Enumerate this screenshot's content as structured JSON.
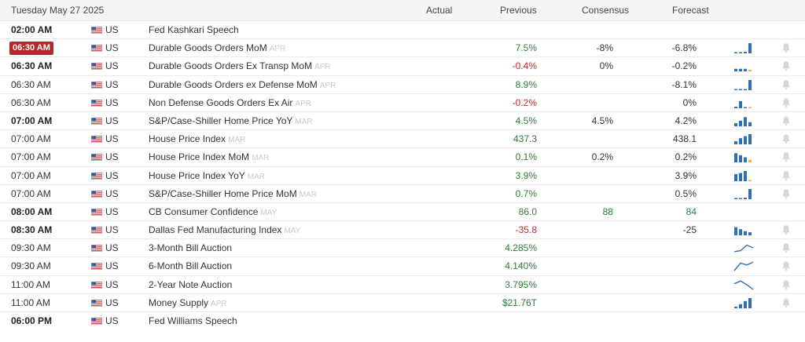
{
  "header": {
    "date": "Tuesday May 27 2025",
    "col_actual": "Actual",
    "col_previous": "Previous",
    "col_consensus": "Consensus",
    "col_forecast": "Forecast"
  },
  "colors": {
    "positive": "#2e7d32",
    "negative": "#c62828",
    "live_badge": "#b22a2a",
    "spark_blue": "#2f6fb5",
    "spark_yellow": "#f0b23a"
  },
  "rows": [
    {
      "time": "02:00 AM",
      "time_style": "bold",
      "country": "US",
      "event": "Fed Kashkari Speech",
      "ref": "",
      "actual": "",
      "previous": "",
      "previous_tone": "neutral",
      "consensus": "",
      "forecast": "",
      "spark": "none",
      "bell": false
    },
    {
      "time": "06:30 AM",
      "time_style": "live",
      "country": "US",
      "event": "Durable Goods Orders MoM",
      "ref": "APR",
      "actual": "",
      "previous": "7.5%",
      "previous_tone": "pos",
      "consensus": "-8%",
      "forecast": "-6.8%",
      "spark": "bars",
      "bars": [
        0.1,
        0.1,
        0.15,
        1.0
      ],
      "bell": true
    },
    {
      "time": "06:30 AM",
      "time_style": "bold",
      "country": "US",
      "event": "Durable Goods Orders Ex Transp MoM",
      "ref": "APR",
      "actual": "",
      "previous": "-0.4%",
      "previous_tone": "neg",
      "consensus": "0%",
      "forecast": "-0.2%",
      "spark": "bars",
      "bars": [
        0.25,
        0.25,
        0.25,
        0.15
      ],
      "bell": true
    },
    {
      "time": "06:30 AM",
      "time_style": "normal",
      "country": "US",
      "event": "Durable Goods Orders ex Defense MoM",
      "ref": "APR",
      "actual": "",
      "previous": "8.9%",
      "previous_tone": "pos",
      "consensus": "",
      "forecast": "-8.1%",
      "spark": "bars",
      "bars": [
        0.1,
        0.1,
        0.1,
        1.0
      ],
      "bell": true
    },
    {
      "time": "06:30 AM",
      "time_style": "normal",
      "country": "US",
      "event": "Non Defense Goods Orders Ex Air",
      "ref": "APR",
      "actual": "",
      "previous": "-0.2%",
      "previous_tone": "neg",
      "consensus": "",
      "forecast": "0%",
      "spark": "bars",
      "bars": [
        0.15,
        0.7,
        0.1,
        0.1
      ],
      "bell": true
    },
    {
      "time": "07:00 AM",
      "time_style": "bold",
      "country": "US",
      "event": "S&P/Case-Shiller Home Price YoY",
      "ref": "MAR",
      "actual": "",
      "previous": "4.5%",
      "previous_tone": "pos",
      "consensus": "4.5%",
      "forecast": "4.2%",
      "spark": "bars",
      "bars": [
        0.3,
        0.55,
        0.9,
        0.4
      ],
      "bell": true
    },
    {
      "time": "07:00 AM",
      "time_style": "normal",
      "country": "US",
      "event": "House Price Index",
      "ref": "MAR",
      "actual": "",
      "previous": "437.3",
      "previous_tone": "pos",
      "consensus": "",
      "forecast": "438.1",
      "spark": "bars",
      "bars": [
        0.3,
        0.6,
        0.8,
        1.0
      ],
      "bell": true
    },
    {
      "time": "07:00 AM",
      "time_style": "normal",
      "country": "US",
      "event": "House Price Index MoM",
      "ref": "MAR",
      "actual": "",
      "previous": "0.1%",
      "previous_tone": "pos",
      "consensus": "0.2%",
      "forecast": "0.2%",
      "spark": "bars",
      "bars": [
        0.9,
        0.7,
        0.5,
        0.25
      ],
      "bell": true
    },
    {
      "time": "07:00 AM",
      "time_style": "normal",
      "country": "US",
      "event": "House Price Index YoY",
      "ref": "MAR",
      "actual": "",
      "previous": "3.9%",
      "previous_tone": "pos",
      "consensus": "",
      "forecast": "3.9%",
      "spark": "bars",
      "bars": [
        0.7,
        0.8,
        1.0,
        0.1
      ],
      "bell": true
    },
    {
      "time": "07:00 AM",
      "time_style": "normal",
      "country": "US",
      "event": "S&P/Case-Shiller Home Price MoM",
      "ref": "MAR",
      "actual": "",
      "previous": "0.7%",
      "previous_tone": "pos",
      "consensus": "",
      "forecast": "0.5%",
      "spark": "bars",
      "bars": [
        0.1,
        0.1,
        0.15,
        1.0
      ],
      "bell": true
    },
    {
      "time": "08:00 AM",
      "time_style": "bold",
      "country": "US",
      "event": "CB Consumer Confidence",
      "ref": "MAY",
      "actual": "",
      "previous": "86.0",
      "previous_tone": "pos",
      "consensus": "88",
      "consensus_tone": "pos",
      "forecast": "84",
      "forecast_tone": "pos",
      "spark": "none",
      "bell": false
    },
    {
      "time": "08:30 AM",
      "time_style": "bold",
      "country": "US",
      "event": "Dallas Fed Manufacturing Index",
      "ref": "MAY",
      "actual": "",
      "previous": "-35.8",
      "previous_tone": "neg",
      "consensus": "",
      "forecast": "-25",
      "spark": "bars",
      "bars": [
        0.8,
        0.6,
        0.4,
        0.3
      ],
      "bell": true
    },
    {
      "time": "09:30 AM",
      "time_style": "normal",
      "country": "US",
      "event": "3-Month Bill Auction",
      "ref": "",
      "actual": "",
      "previous": "4.285%",
      "previous_tone": "pos",
      "consensus": "",
      "forecast": "",
      "spark": "line",
      "line": [
        0.1,
        0.2,
        0.8,
        0.5
      ],
      "bell": true
    },
    {
      "time": "09:30 AM",
      "time_style": "normal",
      "country": "US",
      "event": "6-Month Bill Auction",
      "ref": "",
      "actual": "",
      "previous": "4.140%",
      "previous_tone": "pos",
      "consensus": "",
      "forecast": "",
      "spark": "line",
      "line": [
        0.0,
        0.8,
        0.6,
        0.9
      ],
      "bell": true
    },
    {
      "time": "11:00 AM",
      "time_style": "normal",
      "country": "US",
      "event": "2-Year Note Auction",
      "ref": "",
      "actual": "",
      "previous": "3.795%",
      "previous_tone": "pos",
      "consensus": "",
      "forecast": "",
      "spark": "line",
      "line": [
        0.6,
        0.9,
        0.5,
        0.0
      ],
      "bell": true
    },
    {
      "time": "11:00 AM",
      "time_style": "normal",
      "country": "US",
      "event": "Money Supply",
      "ref": "APR",
      "actual": "",
      "previous": "$21.76T",
      "previous_tone": "pos",
      "consensus": "",
      "forecast": "",
      "spark": "bars",
      "bars": [
        0.15,
        0.4,
        0.7,
        1.0
      ],
      "bell": true
    },
    {
      "time": "06:00 PM",
      "time_style": "bold",
      "country": "US",
      "event": "Fed Williams Speech",
      "ref": "",
      "actual": "",
      "previous": "",
      "previous_tone": "neutral",
      "consensus": "",
      "forecast": "",
      "spark": "none",
      "bell": false
    }
  ]
}
